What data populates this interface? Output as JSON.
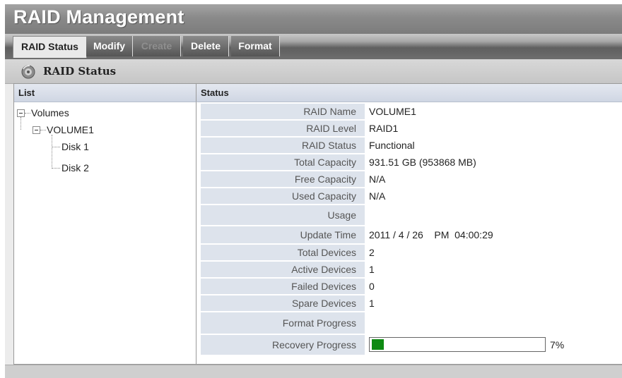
{
  "app": {
    "title": "RAID Management"
  },
  "tabs": [
    {
      "label": "RAID Status",
      "state": "active"
    },
    {
      "label": "Modify",
      "state": "normal"
    },
    {
      "label": "Create",
      "state": "disabled"
    },
    {
      "label": "Delete",
      "state": "normal"
    },
    {
      "label": "Format",
      "state": "normal"
    }
  ],
  "section": {
    "title": "RAID Status",
    "icon": "disk-icon"
  },
  "list": {
    "header": "List",
    "root": "Volumes",
    "volume": "VOLUME1",
    "disks": [
      "Disk 1",
      "Disk 2"
    ]
  },
  "status": {
    "header": "Status",
    "rows": [
      {
        "label": "RAID Name",
        "value": "VOLUME1"
      },
      {
        "label": "RAID Level",
        "value": "RAID1"
      },
      {
        "label": "RAID Status",
        "value": "Functional"
      },
      {
        "label": "Total Capacity",
        "value": "931.51 GB (953868 MB)"
      },
      {
        "label": "Free Capacity",
        "value": "N/A"
      },
      {
        "label": "Used Capacity",
        "value": "N/A"
      },
      {
        "label": "Usage",
        "value": ""
      },
      {
        "label": "Update Time",
        "value": "2011 / 4 / 26    PM  04:00:29"
      },
      {
        "label": "Total Devices",
        "value": "2"
      },
      {
        "label": "Active Devices",
        "value": "1"
      },
      {
        "label": "Failed Devices",
        "value": "0"
      },
      {
        "label": "Spare Devices",
        "value": "1"
      },
      {
        "label": "Format Progress",
        "value": ""
      },
      {
        "label": "Recovery Progress",
        "value": "7%"
      }
    ],
    "recovery_progress_fraction": 0.07
  },
  "colors": {
    "progress": "#0e8a12",
    "label_bg": "#dde3ec"
  }
}
